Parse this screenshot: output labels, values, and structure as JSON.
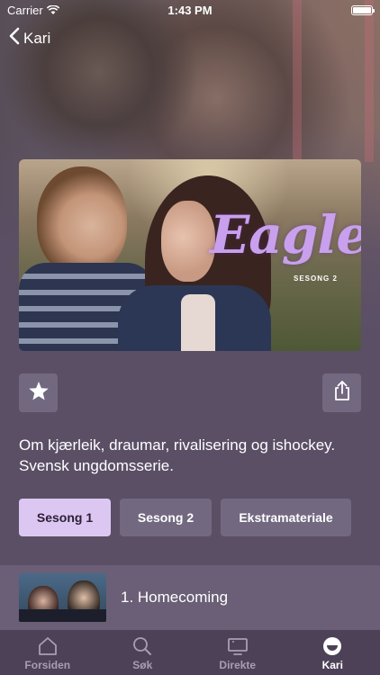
{
  "status_bar": {
    "carrier": "Carrier",
    "time": "1:43 PM"
  },
  "nav": {
    "back_label": "Kari"
  },
  "poster": {
    "title": "Eagles",
    "season_label": "SESONG 2"
  },
  "description": "Om kjærleik, draumar, rivalisering og ishockey. Svensk ungdomsserie.",
  "season_tabs": [
    {
      "label": "Sesong 1",
      "active": true
    },
    {
      "label": "Sesong 2",
      "active": false
    },
    {
      "label": "Ekstramateriale",
      "active": false
    }
  ],
  "episodes": [
    {
      "title": "1. Homecoming"
    }
  ],
  "tab_bar": [
    {
      "label": "Forsiden",
      "icon": "home-icon",
      "active": false
    },
    {
      "label": "Søk",
      "icon": "search-icon",
      "active": false
    },
    {
      "label": "Direkte",
      "icon": "tv-icon",
      "active": false
    },
    {
      "label": "Kari",
      "icon": "profile-icon",
      "active": true
    }
  ],
  "colors": {
    "background": "#5b4f66",
    "button": "#726880",
    "active_tab": "#dcc7f2",
    "tab_bar": "#4c4157",
    "title_accent": "#c8a0ee"
  }
}
